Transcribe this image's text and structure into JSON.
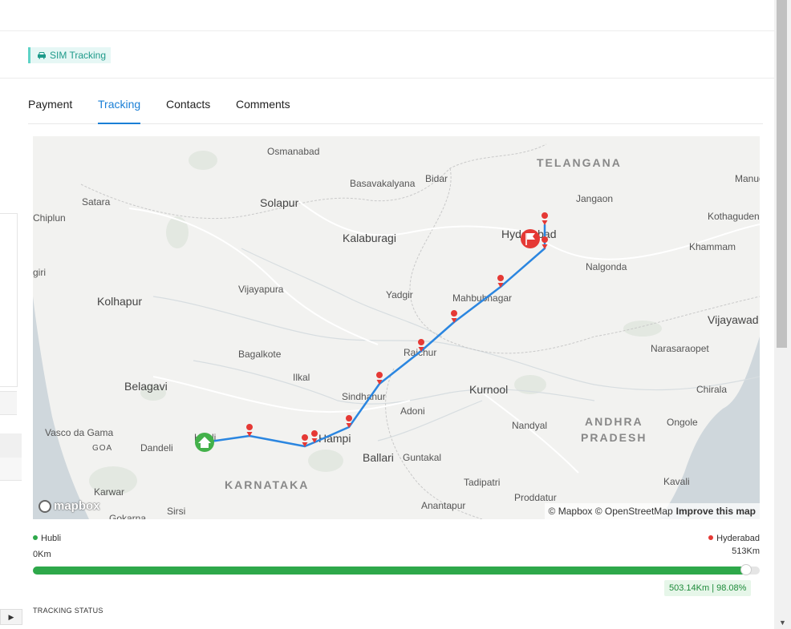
{
  "header": {
    "badge_label": "SIM Tracking",
    "badge_icon": "car-icon"
  },
  "tabs": [
    {
      "label": "Payment",
      "active": false
    },
    {
      "label": "Tracking",
      "active": true
    },
    {
      "label": "Contacts",
      "active": false
    },
    {
      "label": "Comments",
      "active": false
    }
  ],
  "map": {
    "logo_text": "mapbox",
    "attribution": "© Mapbox © OpenStreetMap",
    "improve_link": "Improve this map",
    "labels": {
      "osmanabad": "Osmanabad",
      "telangana": "TELANGANA",
      "bidar": "Bidar",
      "basavakalyana": "Basavakalyana",
      "jangaon": "Jangaon",
      "manug": "Manug",
      "satara": "Satara",
      "solapur": "Solapur",
      "chiplun": "Chiplun",
      "kothaguden": "Kothaguden",
      "kalaburagi": "Kalaburagi",
      "hyderabad": "Hyderabad",
      "khammam": "Khammam",
      "giri": "giri",
      "nalgonda": "Nalgonda",
      "vijayapura": "Vijayapura",
      "yadgir": "Yadgir",
      "kolhapur": "Kolhapur",
      "mahbubnagar": "Mahbubnagar",
      "vijayawada": "Vijayawad",
      "bagalkote": "Bagalkote",
      "raichur": "Raichur",
      "narasaraopet": "Narasaraopet",
      "ilkal": "Ilkal",
      "belagavi": "Belagavi",
      "kurnool": "Kurnool",
      "chirala": "Chirala",
      "sindhanur": "Sindhanur",
      "adoni": "Adoni",
      "andhra": "ANDHRA",
      "pradesh": "PRADESH",
      "vasco": "Vasco da Gama",
      "hubli": "Hubli",
      "hampi": "Hampi",
      "nandyal": "Nandyal",
      "ongole": "Ongole",
      "goa": "GOA",
      "dandeli": "Dandeli",
      "ballari": "Ballari",
      "guntakal": "Guntakal",
      "karnataka": "KARNATAKA",
      "tadipatri": "Tadipatri",
      "kavali": "Kavali",
      "karwar": "Karwar",
      "proddatur": "Proddatur",
      "sirsi": "Sirsi",
      "anantapur": "Anantapur",
      "gokarna": "Gokarna"
    }
  },
  "progress": {
    "origin_name": "Hubli",
    "origin_km": "0Km",
    "destination_name": "Hyderabad",
    "destination_km": "513Km",
    "fraction": 0.9808,
    "tag": "503.14Km | 98.08%",
    "fill_color": "#2ea84a",
    "origin_color": "#2ea84a",
    "destination_color": "#e53935"
  },
  "tracking_status_title": "TRACKING STATUS",
  "route_color": "#2b86e0",
  "pin_color": "#e53935"
}
